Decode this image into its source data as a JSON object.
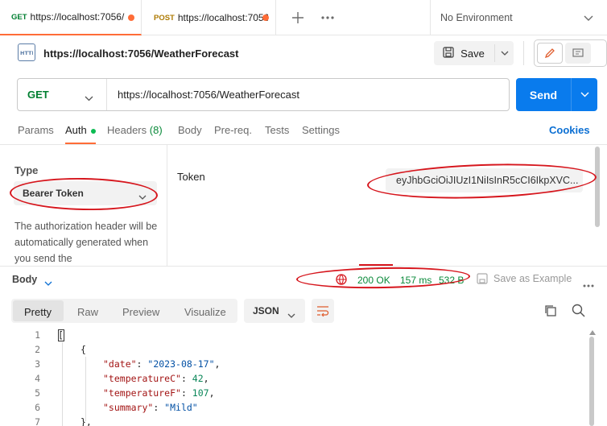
{
  "tabs": [
    {
      "method": "GET",
      "url": "https://localhost:7056/"
    },
    {
      "method": "POST",
      "url": "https://localhost:7056"
    }
  ],
  "env": {
    "label": "No Environment"
  },
  "title": {
    "text": "https://localhost:7056/WeatherForecast",
    "save_label": "Save"
  },
  "request": {
    "method": "GET",
    "url": "https://localhost:7056/WeatherForecast",
    "send_label": "Send"
  },
  "subtabs": {
    "params": "Params",
    "auth": "Auth",
    "headers": "Headers",
    "headers_count": "(8)",
    "body": "Body",
    "prereq": "Pre-req.",
    "tests": "Tests",
    "settings": "Settings",
    "cookies": "Cookies"
  },
  "auth": {
    "type_label": "Type",
    "type_value": "Bearer Token",
    "description": "The authorization header will be automatically generated when you send the",
    "token_label": "Token",
    "token_value": "eyJhbGciOiJIUzI1NiIsInR5cCI6IkpXVC..."
  },
  "response": {
    "body_label": "Body",
    "status": "200 OK",
    "time": "157 ms",
    "size": "532 B",
    "save_example": "Save as Example"
  },
  "view": {
    "pretty": "Pretty",
    "raw": "Raw",
    "preview": "Preview",
    "visualize": "Visualize",
    "format": "JSON"
  },
  "code": {
    "line_numbers": [
      "1",
      "2",
      "3",
      "4",
      "5",
      "6",
      "7"
    ],
    "l1": "[",
    "l2": "{",
    "k_date": "\"date\"",
    "v_date": "\"2023-08-17\"",
    "k_tc": "\"temperatureC\"",
    "v_tc": "42",
    "k_tf": "\"temperatureF\"",
    "v_tf": "107",
    "k_sum": "\"summary\"",
    "v_sum": "\"Mild\"",
    "l7": "},"
  }
}
